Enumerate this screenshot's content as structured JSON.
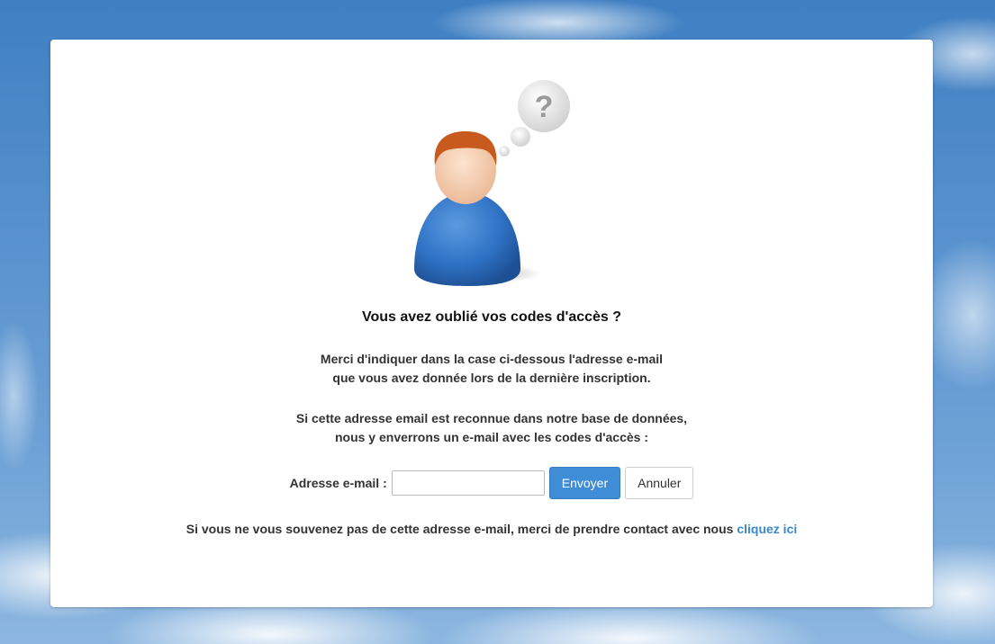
{
  "page": {
    "title": "Vous avez oublié vos codes d'accès ?",
    "paragraph1": {
      "line1": "Merci d'indiquer dans la case ci-dessous l'adresse e-mail",
      "line2": "que vous avez donnée lors de la dernière inscription."
    },
    "paragraph2": {
      "line1": "Si cette adresse email est reconnue dans notre base de données,",
      "line2": "nous y enverrons un e-mail avec les codes d'accès :"
    },
    "form": {
      "email_label": "Adresse e-mail :",
      "email_value": "",
      "email_placeholder": "",
      "submit_label": "Envoyer",
      "cancel_label": "Annuler"
    },
    "contact": {
      "text": "Si vous ne vous souvenez pas de cette adresse e-mail, merci de prendre contact avec nous",
      "link_label": "cliquez ici"
    }
  },
  "illustration": {
    "icon": "forgot-password-person-icon",
    "thought_symbol": "?"
  },
  "colors": {
    "primary_button": "#3f8dd6",
    "link": "#3a87cc",
    "person_body": "#2f72c4",
    "person_hair": "#c85a1e",
    "background_sky": "#4a86c6"
  }
}
